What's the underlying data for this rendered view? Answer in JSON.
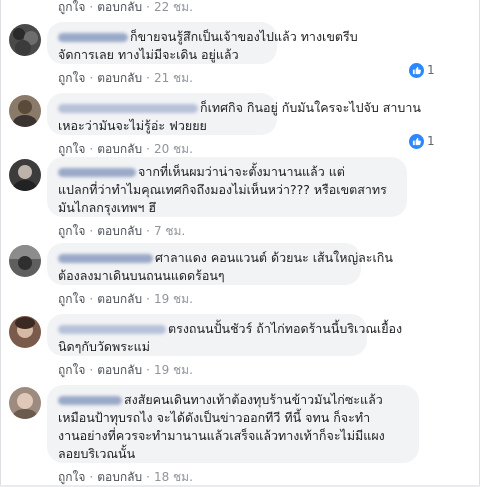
{
  "actions": {
    "like": "ถูกใจ",
    "reply": "ตอบกลับ",
    "separator": "·"
  },
  "colors": {
    "bubble": "#f2f3f5",
    "link_blue": "#385898",
    "like_blue": "#2d88ff",
    "meta_gray": "#90949c"
  },
  "comments": [
    {
      "name": "",
      "lines": [],
      "time": "22 ชม.",
      "reactions": null
    },
    {
      "name": "",
      "lines": [
        "ก็ขายจนรู้สึกเป็นเจ้าของไปแล้ว ทางเขตรีบ",
        "จัดการเลย ทางไม่มีจะเดิน อยู่แล้ว"
      ],
      "time": "21 ชม.",
      "reactions": {
        "icon": "like-icon",
        "count": "1"
      }
    },
    {
      "name": "",
      "lines": [
        "ก็เทศกิจ กินอยู่ กับมันใครจะไปจับ สาบาน",
        "เหอะว่ามันจะไม่รู้อ่ะ ฟวยยย"
      ],
      "time": "20 ชม.",
      "reactions": {
        "icon": "like-icon",
        "count": "1"
      }
    },
    {
      "name": "",
      "lines": [
        "จากที่เห็นผมว่าน่าจะตั้งมานานแล้ว แต่",
        "แปลกที่ว่าทำไมคุณเทศกิจถึงมองไม่เห็นหว่า??? หรือเขตสาทร",
        "มันไกลกรุงเทพฯ ฮึ"
      ],
      "time": "7 ชม.",
      "reactions": null
    },
    {
      "name": "",
      "lines": [
        "ศาลาแดง คอนแวนต์ ด้วยนะ เส้นใหญ่ละเกิน",
        "ต้องลงมาเดินบนถนนแดดร้อนๆ"
      ],
      "time": "19 ชม.",
      "reactions": null
    },
    {
      "name": "",
      "lines": [
        "ตรงถนนปั้นชัวร์ ถ้าไก่ทอดร้านนี้บริเวณเยื้อง",
        "นิดๆกับวัดพระแม่"
      ],
      "time": "19 ชม.",
      "reactions": null
    },
    {
      "name": "",
      "lines": [
        "สงสัยคนเดินทางเท้าต้องทุบร้านข้าวมันไก่ซะแล้ว",
        "เหมือนป้าทุบรถไง จะได้ดังเป็นข่าวออกทีวี ทีนี้ จทน ก็จะทำ",
        "งานอย่างที่ควรจะทำมานานแล้วเสร็จแล้วทางเท้าก็จะไม่มีแผง",
        "ลอยบริเวณนั้น"
      ],
      "time": "18 ชม.",
      "reactions": null
    }
  ]
}
